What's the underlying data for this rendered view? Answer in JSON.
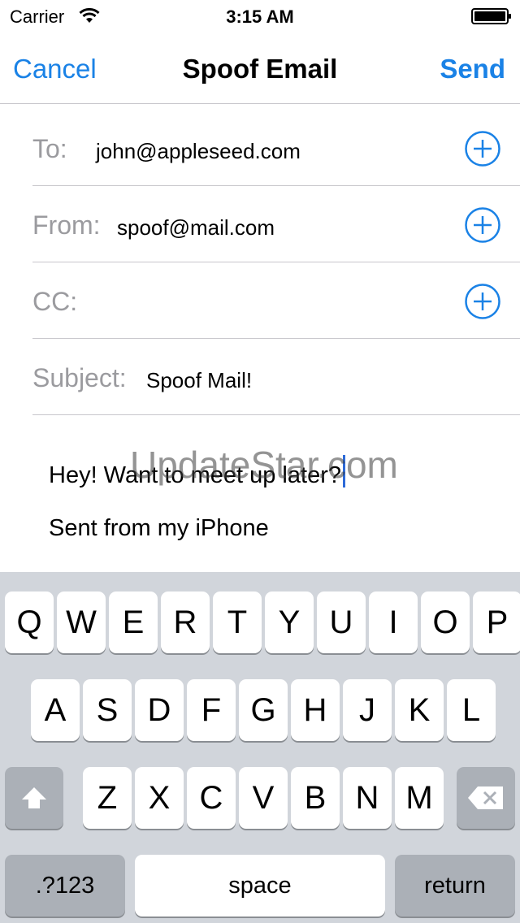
{
  "status_bar": {
    "carrier": "Carrier",
    "time": "3:15 AM"
  },
  "nav": {
    "cancel": "Cancel",
    "title": "Spoof Email",
    "send": "Send"
  },
  "fields": {
    "to": {
      "label": "To:",
      "value": "john@appleseed.com"
    },
    "from": {
      "label": "From:",
      "value": "spoof@mail.com"
    },
    "cc": {
      "label": "CC:",
      "value": ""
    },
    "subject": {
      "label": "Subject:",
      "value": "Spoof Mail!"
    }
  },
  "body": {
    "message": "Hey! Want to meet up later?",
    "signature": "Sent from my iPhone"
  },
  "watermark": "UpdateStar.com",
  "keyboard": {
    "row1": [
      "Q",
      "W",
      "E",
      "R",
      "T",
      "Y",
      "U",
      "I",
      "O",
      "P"
    ],
    "row2": [
      "A",
      "S",
      "D",
      "F",
      "G",
      "H",
      "J",
      "K",
      "L"
    ],
    "row3": [
      "Z",
      "X",
      "C",
      "V",
      "B",
      "N",
      "M"
    ],
    "numbers_key": ".?123",
    "space_key": "space",
    "return_key": "return"
  },
  "colors": {
    "accent": "#1a82e6",
    "placeholder_gray": "#9b9b9f",
    "keyboard_bg": "#d1d5db",
    "function_key": "#abb0b7",
    "cursor": "#2e6ad8"
  }
}
